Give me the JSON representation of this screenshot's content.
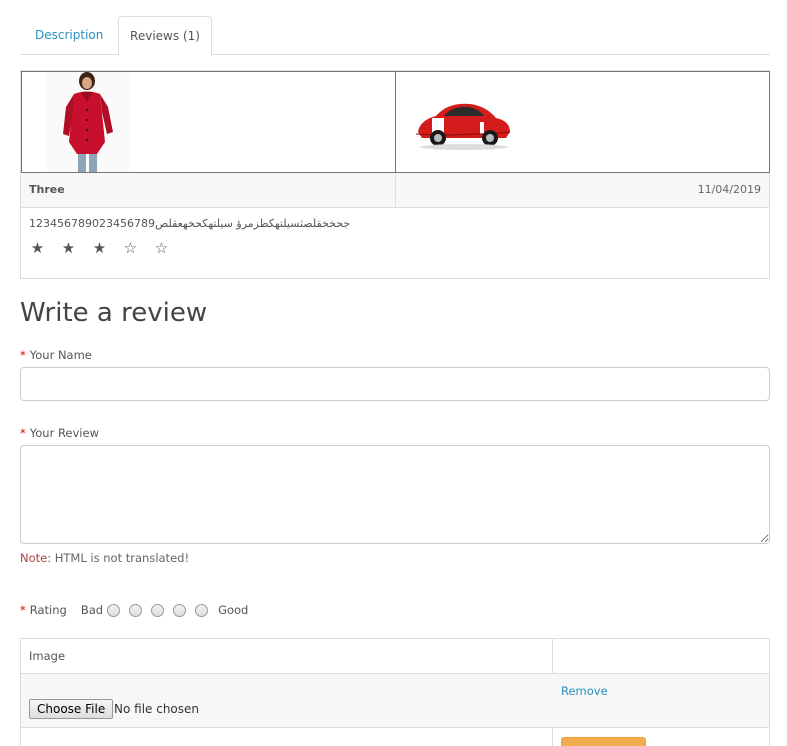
{
  "tabs": [
    {
      "label": "Description",
      "active": false
    },
    {
      "label": "Reviews (1)",
      "active": true
    }
  ],
  "review": {
    "author": "Three",
    "date": "11/04/2019",
    "text": "جحخخقلصثسيلتهكظزمرؤ سيلتهكحخهعقلص123456789023456789",
    "rating": 3,
    "max_rating": 5,
    "images": [
      "woman-red-coat-photo",
      "red-sports-car-photo"
    ]
  },
  "form": {
    "title": "Write a review",
    "name_label": "Your Name",
    "name_value": "",
    "review_label": "Your Review",
    "review_value": "",
    "note_key": "Note:",
    "note_text": " HTML is not translated!",
    "rating_label": "Rating",
    "rating_bad": "Bad",
    "rating_good": "Good"
  },
  "upload": {
    "header": "Image",
    "choose_label": "Choose File",
    "status": "No file chosen",
    "remove_label": "Remove"
  },
  "colors": {
    "link": "#2a8fbd",
    "required": "#cc0000",
    "button_orange": "#f0ad4e"
  }
}
